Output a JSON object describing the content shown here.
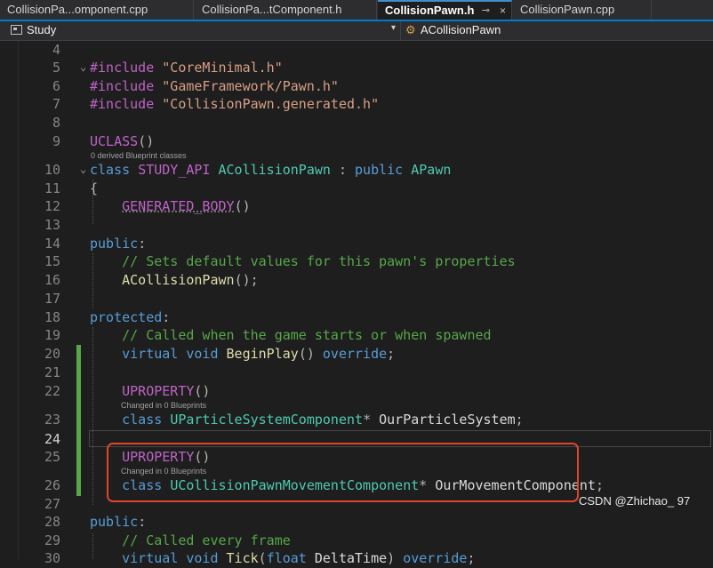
{
  "tabs": [
    {
      "label": "CollisionPa...omponent.cpp"
    },
    {
      "label": "CollisionPa...tComponent.h"
    },
    {
      "label": "CollisionPawn.h",
      "pin": "⊸",
      "close": "×"
    },
    {
      "label": "CollisionPawn.cpp"
    }
  ],
  "navbar": {
    "project": "Study",
    "arrow": "▾",
    "class_scope": "ACollisionPawn"
  },
  "lines": [
    {
      "n": "4"
    },
    {
      "n": "5"
    },
    {
      "n": "6"
    },
    {
      "n": "7"
    },
    {
      "n": "8"
    },
    {
      "n": "9"
    },
    {
      "n": "10"
    },
    {
      "n": "11"
    },
    {
      "n": "12"
    },
    {
      "n": "13"
    },
    {
      "n": "14"
    },
    {
      "n": "15"
    },
    {
      "n": "16"
    },
    {
      "n": "17"
    },
    {
      "n": "18"
    },
    {
      "n": "19"
    },
    {
      "n": "20"
    },
    {
      "n": "21"
    },
    {
      "n": "22"
    },
    {
      "n": "23"
    },
    {
      "n": "24"
    },
    {
      "n": "25"
    },
    {
      "n": "26"
    },
    {
      "n": "27"
    },
    {
      "n": "28"
    },
    {
      "n": "29"
    },
    {
      "n": "30"
    }
  ],
  "code": {
    "l5_include": "#include",
    "l5_str": "\"CoreMinimal.h\"",
    "l6_include": "#include",
    "l6_str": "\"GameFramework/Pawn.h\"",
    "l7_include": "#include",
    "l7_str": "\"CollisionPawn.generated.h\"",
    "l9_macro": "UCLASS",
    "l9_paren": "()",
    "l10_class": "class",
    "l10_api": "STUDY_API",
    "l10_name": "ACollisionPawn",
    "l10_colon": ":",
    "l10_public": "public",
    "l10_base": "APawn",
    "l11_brace": "{",
    "l12_macro": "GENERATED_BODY",
    "l12_paren": "()",
    "l14_public": "public",
    "l14_colon": ":",
    "l15_comment": "// Sets default values for this pawn's properties",
    "l16_ctor": "ACollisionPawn",
    "l16_tail": "();",
    "l18_protected": "protected",
    "l18_colon": ":",
    "l19_comment": "// Called when the game starts or when spawned",
    "l20_virtual": "virtual",
    "l20_void": "void",
    "l20_fn": "BeginPlay",
    "l20_paren": "()",
    "l20_override": "override",
    "l20_semi": ";",
    "l22_macro": "UPROPERTY",
    "l22_paren": "()",
    "l23_class": "class",
    "l23_type": "UParticleSystemComponent",
    "l23_star": "*",
    "l23_var": "OurParticleSystem",
    "l23_semi": ";",
    "l25_macro": "UPROPERTY",
    "l25_paren": "()",
    "l26_class": "class",
    "l26_type": "UCollisionPawnMovementComponent",
    "l26_star": "*",
    "l26_var": "OurMovementComponent",
    "l26_semi": ";",
    "l28_public": "public",
    "l28_colon": ":",
    "l29_comment": "// Called every frame",
    "l30_virtual": "virtual",
    "l30_void": "void",
    "l30_fn": "Tick",
    "l30_open": "(",
    "l30_float": "float",
    "l30_param": "DeltaTime",
    "l30_close": ")",
    "l30_override": "override",
    "l30_semi": ";"
  },
  "codelens": {
    "uclass": "0 derived Blueprint classes",
    "particle": "Changed in 0 Blueprints",
    "movement": "Changed in 0 Blueprints"
  },
  "collapse_glyph": "⌄",
  "watermark": "CSDN @Zhichao_ 97",
  "colors": {
    "accent": "#007acc",
    "keyword": "#569cd6",
    "type": "#4ec9b0",
    "string": "#d69d85",
    "comment": "#57a64a",
    "function": "#dcdcaa",
    "macro": "#bd63c5",
    "highlight_box": "#e0452c"
  }
}
